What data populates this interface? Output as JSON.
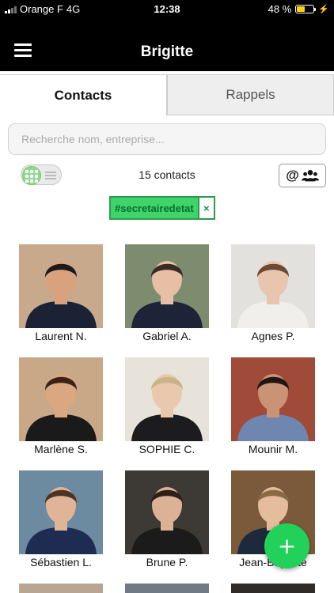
{
  "status_bar": {
    "carrier": "Orange F",
    "network": "4G",
    "time": "12:38",
    "battery": "48 %",
    "battery_level": 0.48
  },
  "header": {
    "title": "Brigitte"
  },
  "tabs": [
    {
      "label": "Contacts",
      "active": true
    },
    {
      "label": "Rappels",
      "active": false
    }
  ],
  "search": {
    "placeholder": "Recherche nom, entreprise...",
    "value": ""
  },
  "toolbar": {
    "contact_count": "15 contacts",
    "group_button_symbol": "@"
  },
  "filter_tag": {
    "label": "#secretairedetat",
    "remove_symbol": "×"
  },
  "contacts": [
    {
      "name": "Laurent N.",
      "bg": "#c9a98c",
      "skin": "#d9a27f",
      "hair": "#1c1a1a",
      "shirt": "#1b2236"
    },
    {
      "name": "Gabriel A.",
      "bg": "#7d8b6e",
      "skin": "#e6bfa4",
      "hair": "#3a2a22",
      "shirt": "#1d2438"
    },
    {
      "name": "Agnes P.",
      "bg": "#e3e1dd",
      "skin": "#e8c6ae",
      "hair": "#6b4a33",
      "shirt": "#f1efec"
    },
    {
      "name": "Marlène S.",
      "bg": "#c9a888",
      "skin": "#dba781",
      "hair": "#3b2216",
      "shirt": "#1a1a1a"
    },
    {
      "name": "SOPHIE C.",
      "bg": "#e7e2da",
      "skin": "#eac8ae",
      "hair": "#c9b48a",
      "shirt": "#1c1c1e"
    },
    {
      "name": "Mounir M.",
      "bg": "#a04a3a",
      "skin": "#c99476",
      "hair": "#1f1713",
      "shirt": "#6f86b0"
    },
    {
      "name": "Sébastien L.",
      "bg": "#6c8aa0",
      "skin": "#e0b496",
      "hair": "#4a3424",
      "shirt": "#1e2c52"
    },
    {
      "name": "Brune P.",
      "bg": "#3d3935",
      "skin": "#dcb196",
      "hair": "#2b2019",
      "shirt": "#1b1b1b"
    },
    {
      "name": "Jean-Baptiste",
      "bg": "#7a5a3a",
      "skin": "#e5bc9c",
      "hair": "#8a6a44",
      "shirt": "#1d2a3e"
    }
  ],
  "fab": {
    "symbol": "+"
  },
  "colors": {
    "accent_green": "#22d15a",
    "tag_green": "#3ed46a",
    "nav_black": "#000000"
  }
}
